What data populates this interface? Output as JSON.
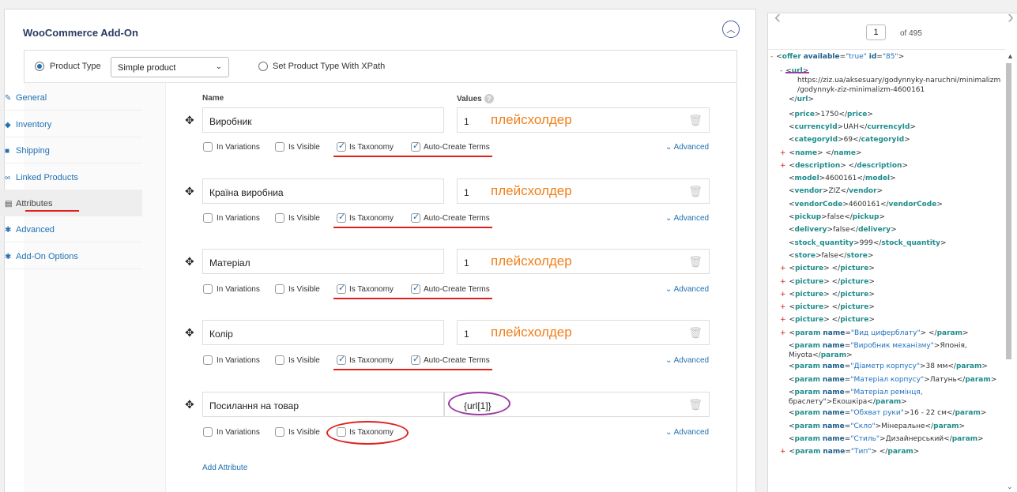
{
  "panel": {
    "title": "WooCommerce Add-On"
  },
  "product_type": {
    "radio_label": "Product Type",
    "selected": "Simple product",
    "xpath_label": "Set Product Type With XPath"
  },
  "sidenav": {
    "items": [
      {
        "label": "General",
        "icon": "wrench-icon"
      },
      {
        "label": "Inventory",
        "icon": "tag-icon"
      },
      {
        "label": "Shipping",
        "icon": "truck-icon"
      },
      {
        "label": "Linked Products",
        "icon": "link-icon"
      },
      {
        "label": "Attributes",
        "icon": "table-icon"
      },
      {
        "label": "Advanced",
        "icon": "gear-icon"
      },
      {
        "label": "Add-On Options",
        "icon": "gear-icon"
      }
    ]
  },
  "attributes": {
    "col_name": "Name",
    "col_values": "Values",
    "labels": {
      "in_variations": "In Variations",
      "is_visible": "Is Visible",
      "is_taxonomy": "Is Taxonomy",
      "auto_create": "Auto-Create Terms",
      "advanced": "Advanced"
    },
    "rows": [
      {
        "name": "Виробник",
        "value": "1",
        "placeholder": "плейсхолдер"
      },
      {
        "name": "Країна виробниа",
        "value": "1",
        "placeholder": "плейсхолдер"
      },
      {
        "name": "Матеріал",
        "value": "1",
        "placeholder": "плейсхолдер"
      },
      {
        "name": "Колір",
        "value": "1",
        "placeholder": "плейсхолдер"
      },
      {
        "name": "Посилання на товар",
        "value": "{url[1]}",
        "placeholder": ""
      }
    ],
    "add_label": "Add Attribute"
  },
  "xml": {
    "page": "1",
    "of": "of 495",
    "header": {
      "tag": "offer",
      "attrs": [
        [
          "available",
          "\"true\""
        ],
        [
          "id",
          "\"85\""
        ]
      ]
    },
    "url_tag": "url",
    "url_text_1": "https://ziz.ua/aksesuary/godynnyky-naruchni/minimalizm",
    "url_text_2": "/godynnyk-ziz-minimalizm-4600161",
    "simple": [
      [
        "price",
        "1750"
      ],
      [
        "currencyId",
        "UAH"
      ],
      [
        "categoryId",
        "69"
      ],
      [
        "name",
        " "
      ],
      [
        "description",
        " "
      ],
      [
        "model",
        "4600161"
      ],
      [
        "vendor",
        "ZIZ"
      ],
      [
        "vendorCode",
        "4600161"
      ],
      [
        "pickup",
        "false"
      ],
      [
        "delivery",
        "false"
      ],
      [
        "stock_quantity",
        "999"
      ],
      [
        "store",
        "false"
      ],
      [
        "picture",
        " "
      ],
      [
        "picture",
        " "
      ],
      [
        "picture",
        " "
      ],
      [
        "picture",
        " "
      ],
      [
        "picture",
        " "
      ]
    ],
    "params": [
      {
        "name": "\"Вид циферблату\"",
        "text": " "
      },
      {
        "name": "\"Виробник механізму\"",
        "text": "Японія,",
        "cont": "Miyota"
      },
      {
        "name": "\"Діаметр корпусу\"",
        "text": "38 мм"
      },
      {
        "name": "\"Матеріал корпусу\"",
        "text": "Латунь"
      },
      {
        "name": "\"Матеріал ремінця,",
        "text": "",
        "cont": "браслету\">Екошкіра"
      },
      {
        "name": "\"Обхват руки\"",
        "text": "16 - 22 см"
      },
      {
        "name": "\"Скло\"",
        "text": "Мінеральне"
      },
      {
        "name": "\"Стиль\"",
        "text": "Дизайнерський"
      },
      {
        "name": "\"Тип\"",
        "text": " "
      }
    ]
  }
}
